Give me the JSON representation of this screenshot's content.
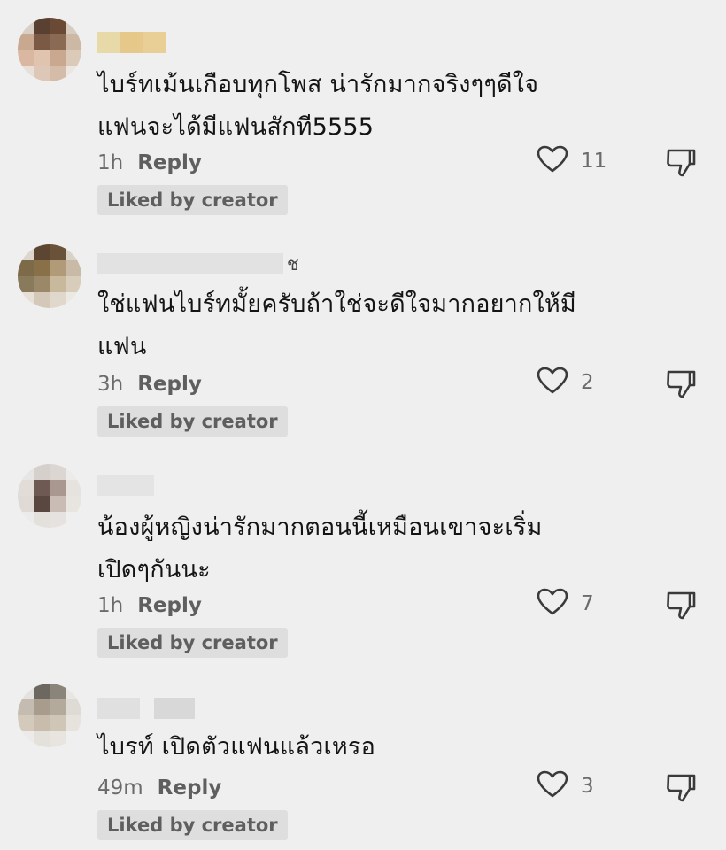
{
  "comments": [
    {
      "text": "ไบร์ทเม้นเกือบทุกโพส น่ารักมากจริงๆๆดีใจ\nแฟนจะได้มีแฟนสักที5555",
      "time": "1h",
      "reply_label": "Reply",
      "likes": "11",
      "badge": "Liked by creator",
      "username_tail": ""
    },
    {
      "text": "ใช่แฟนไบร์ทมั้ยครับถ้าใช่จะดีใจมากอยากให้มี\nแฟน",
      "time": "3h",
      "reply_label": "Reply",
      "likes": "2",
      "badge": "Liked by creator",
      "username_tail": "ช"
    },
    {
      "text": "น้องผู้หญิงน่ารักมากตอนนี้เหมือนเขาจะเริ่ม\nเปิดๆกันนะ",
      "time": "1h",
      "reply_label": "Reply",
      "likes": "7",
      "badge": "Liked by creator",
      "username_tail": ""
    },
    {
      "text": "ไบรท์ เปิดตัวแฟนแล้วเหรอ",
      "time": "49m",
      "reply_label": "Reply",
      "likes": "3",
      "badge": "Liked by creator",
      "username_tail": ""
    }
  ],
  "icons": {
    "like": "heart-outline-icon",
    "dislike": "thumbs-down-outline-icon"
  },
  "colors": {
    "background": "#efefef",
    "text": "#141414",
    "secondary": "#6b6b6b",
    "badge_bg": "#dedede"
  }
}
